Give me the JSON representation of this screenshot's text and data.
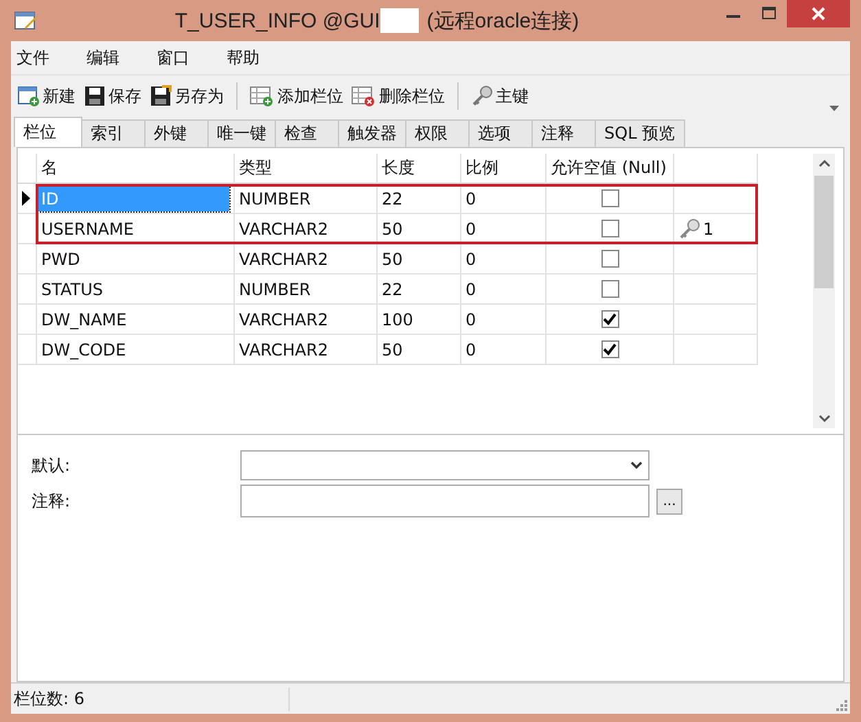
{
  "window": {
    "title": "T_USER_INFO @GUI",
    "title_suffix": "(远程oracle连接)"
  },
  "menu": [
    "文件",
    "编辑",
    "窗口",
    "帮助"
  ],
  "toolbar": [
    {
      "label": "新建",
      "kind": "new"
    },
    {
      "label": "保存",
      "kind": "save"
    },
    {
      "label": "另存为",
      "kind": "saveas"
    },
    {
      "label": "添加栏位",
      "kind": "addcol"
    },
    {
      "label": "删除栏位",
      "kind": "delcol"
    },
    {
      "label": "主键",
      "kind": "key"
    }
  ],
  "tabs": [
    {
      "label": "栏位",
      "selected": true
    },
    {
      "label": "索引",
      "selected": false
    },
    {
      "label": "外键",
      "selected": false
    },
    {
      "label": "唯一键",
      "selected": false
    },
    {
      "label": "检查",
      "selected": false
    },
    {
      "label": "触发器",
      "selected": false
    },
    {
      "label": "权限",
      "selected": false
    },
    {
      "label": "选项",
      "selected": false
    },
    {
      "label": "注释",
      "selected": false
    },
    {
      "label": "SQL 预览",
      "selected": false
    }
  ],
  "table": {
    "columns": [
      "名",
      "类型",
      "长度",
      "比例",
      "允许空值 (Null)"
    ],
    "rows": [
      {
        "name": "ID",
        "type": "NUMBER",
        "length": "22",
        "scale": "0",
        "nullable": false,
        "key": "",
        "selected": true,
        "highlighted": true
      },
      {
        "name": "USERNAME",
        "type": "VARCHAR2",
        "length": "50",
        "scale": "0",
        "nullable": false,
        "key": "1",
        "selected": false,
        "highlighted": true
      },
      {
        "name": "PWD",
        "type": "VARCHAR2",
        "length": "50",
        "scale": "0",
        "nullable": false,
        "key": "",
        "selected": false,
        "highlighted": false
      },
      {
        "name": "STATUS",
        "type": "NUMBER",
        "length": "22",
        "scale": "0",
        "nullable": false,
        "key": "",
        "selected": false,
        "highlighted": false
      },
      {
        "name": "DW_NAME",
        "type": "VARCHAR2",
        "length": "100",
        "scale": "0",
        "nullable": true,
        "key": "",
        "selected": false,
        "highlighted": false
      },
      {
        "name": "DW_CODE",
        "type": "VARCHAR2",
        "length": "50",
        "scale": "0",
        "nullable": true,
        "key": "",
        "selected": false,
        "highlighted": false
      }
    ]
  },
  "form": {
    "default_label": "默认:",
    "comment_label": "注释:",
    "more_button": "..."
  },
  "status_bar": "栏位数: 6"
}
